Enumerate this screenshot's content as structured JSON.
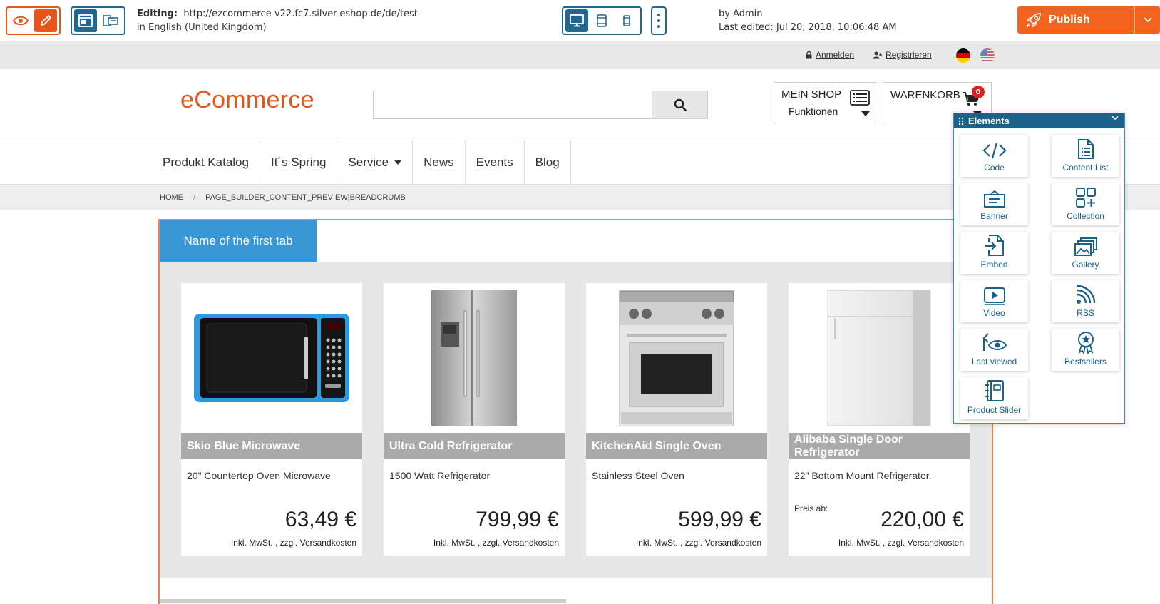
{
  "editor": {
    "editing_label": "Editing:",
    "url": "http://ezcommerce-v22.fc7.silver-eshop.de/de/test",
    "language": "in English (United Kingdom)",
    "author": "by Admin",
    "last_edited": "Last edited: Jul 20, 2018, 10:06:48 AM",
    "publish_label": "Publish",
    "accent_color": "#f2641e",
    "primary_color": "#23678f"
  },
  "topbar": {
    "login": "Anmelden",
    "register": "Registrieren"
  },
  "header": {
    "logo": "eCommerce",
    "search_value": "",
    "myshop_title": "MEIN SHOP",
    "myshop_sub": "Funktionen",
    "cart_title": "WARENKORB",
    "cart_count": "0"
  },
  "nav": {
    "items": [
      "Produkt Katalog",
      "It´s Spring",
      "Service",
      "News",
      "Events",
      "Blog"
    ]
  },
  "breadcrumb": {
    "home": "HOME",
    "sep": "/",
    "current": "PAGE_BUILDER_CONTENT_PREVIEW|BREADCRUMB"
  },
  "content": {
    "tab_label": "Name of the first tab",
    "products": [
      {
        "name": "Skio Blue Microwave",
        "desc": "20\" Countertop Oven Microwave",
        "price": "63,49 €",
        "price_from": "",
        "tax": "Inkl. MwSt. , zzgl. Versandkosten"
      },
      {
        "name": "Ultra Cold Refrigerator",
        "desc": "1500 Watt Refrigerator",
        "price": "799,99 €",
        "price_from": "",
        "tax": "Inkl. MwSt. , zzgl. Versandkosten"
      },
      {
        "name": "KitchenAid Single Oven",
        "desc": "Stainless Steel Oven",
        "price": "599,99 €",
        "price_from": "",
        "tax": "Inkl. MwSt. , zzgl. Versandkosten"
      },
      {
        "name": "Alibaba Single Door Refrigerator",
        "desc": "22\" Bottom Mount Refrigerator.",
        "price": "220,00 €",
        "price_from": "Preis ab:",
        "tax": "Inkl. MwSt. , zzgl. Versandkosten"
      }
    ]
  },
  "elements_panel": {
    "title": "Elements",
    "items": [
      "Code",
      "Content List",
      "Banner",
      "Collection",
      "Embed",
      "Gallery",
      "Video",
      "RSS",
      "Last viewed",
      "Bestsellers",
      "Product Slider"
    ]
  }
}
